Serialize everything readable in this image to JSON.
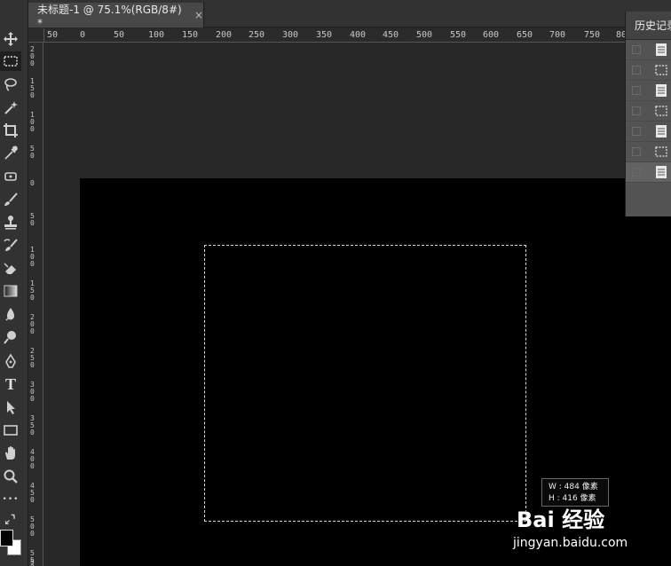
{
  "document_tab": {
    "title": "未标题-1 @ 75.1%(RGB/8#) *",
    "close_glyph": "×"
  },
  "toolbar": {
    "tools": [
      {
        "name": "move-icon"
      },
      {
        "name": "rectangular-marquee-icon",
        "active": true
      },
      {
        "name": "lasso-icon"
      },
      {
        "name": "magic-wand-icon"
      },
      {
        "name": "crop-icon"
      },
      {
        "name": "eyedropper-icon"
      },
      {
        "name": "spot-healing-icon"
      },
      {
        "name": "brush-icon"
      },
      {
        "name": "clone-stamp-icon"
      },
      {
        "name": "history-brush-icon"
      },
      {
        "name": "eraser-icon"
      },
      {
        "name": "gradient-icon"
      },
      {
        "name": "blur-icon"
      },
      {
        "name": "dodge-icon"
      },
      {
        "name": "pen-icon"
      },
      {
        "name": "type-icon"
      },
      {
        "name": "path-selection-icon"
      },
      {
        "name": "rectangle-shape-icon"
      },
      {
        "name": "hand-icon"
      },
      {
        "name": "zoom-icon"
      },
      {
        "name": "more-tools-icon"
      }
    ],
    "type_glyph": "T",
    "more_glyph": "•••",
    "foreground_color": "#000000",
    "background_color": "#ffffff"
  },
  "rulers": {
    "horizontal": [
      "50",
      "0",
      "50",
      "100",
      "150",
      "200",
      "250",
      "300",
      "350",
      "400",
      "450",
      "500",
      "550",
      "600",
      "650",
      "700",
      "750",
      "80"
    ],
    "vertical": [
      "200",
      "150",
      "100",
      "50",
      "0",
      "50",
      "100",
      "150",
      "200",
      "250",
      "300",
      "350",
      "400",
      "450",
      "500",
      "550",
      "5"
    ]
  },
  "canvas": {
    "document_color": "#000000",
    "workspace_color": "#282828",
    "size_tooltip": {
      "width_line": "W : 484 像素",
      "height_line": "H : 416 像素"
    }
  },
  "history_panel": {
    "title": "历史记录",
    "rows": [
      {
        "icon": "document-icon"
      },
      {
        "icon": "marquee-selection-icon"
      },
      {
        "icon": "document-icon"
      },
      {
        "icon": "marquee-selection-icon"
      },
      {
        "icon": "document-icon"
      },
      {
        "icon": "marquee-selection-icon"
      },
      {
        "icon": "document-icon",
        "selected": true
      }
    ]
  },
  "watermark": {
    "logo_text": "Bai 经验",
    "url": "jingyan.baidu.com"
  }
}
